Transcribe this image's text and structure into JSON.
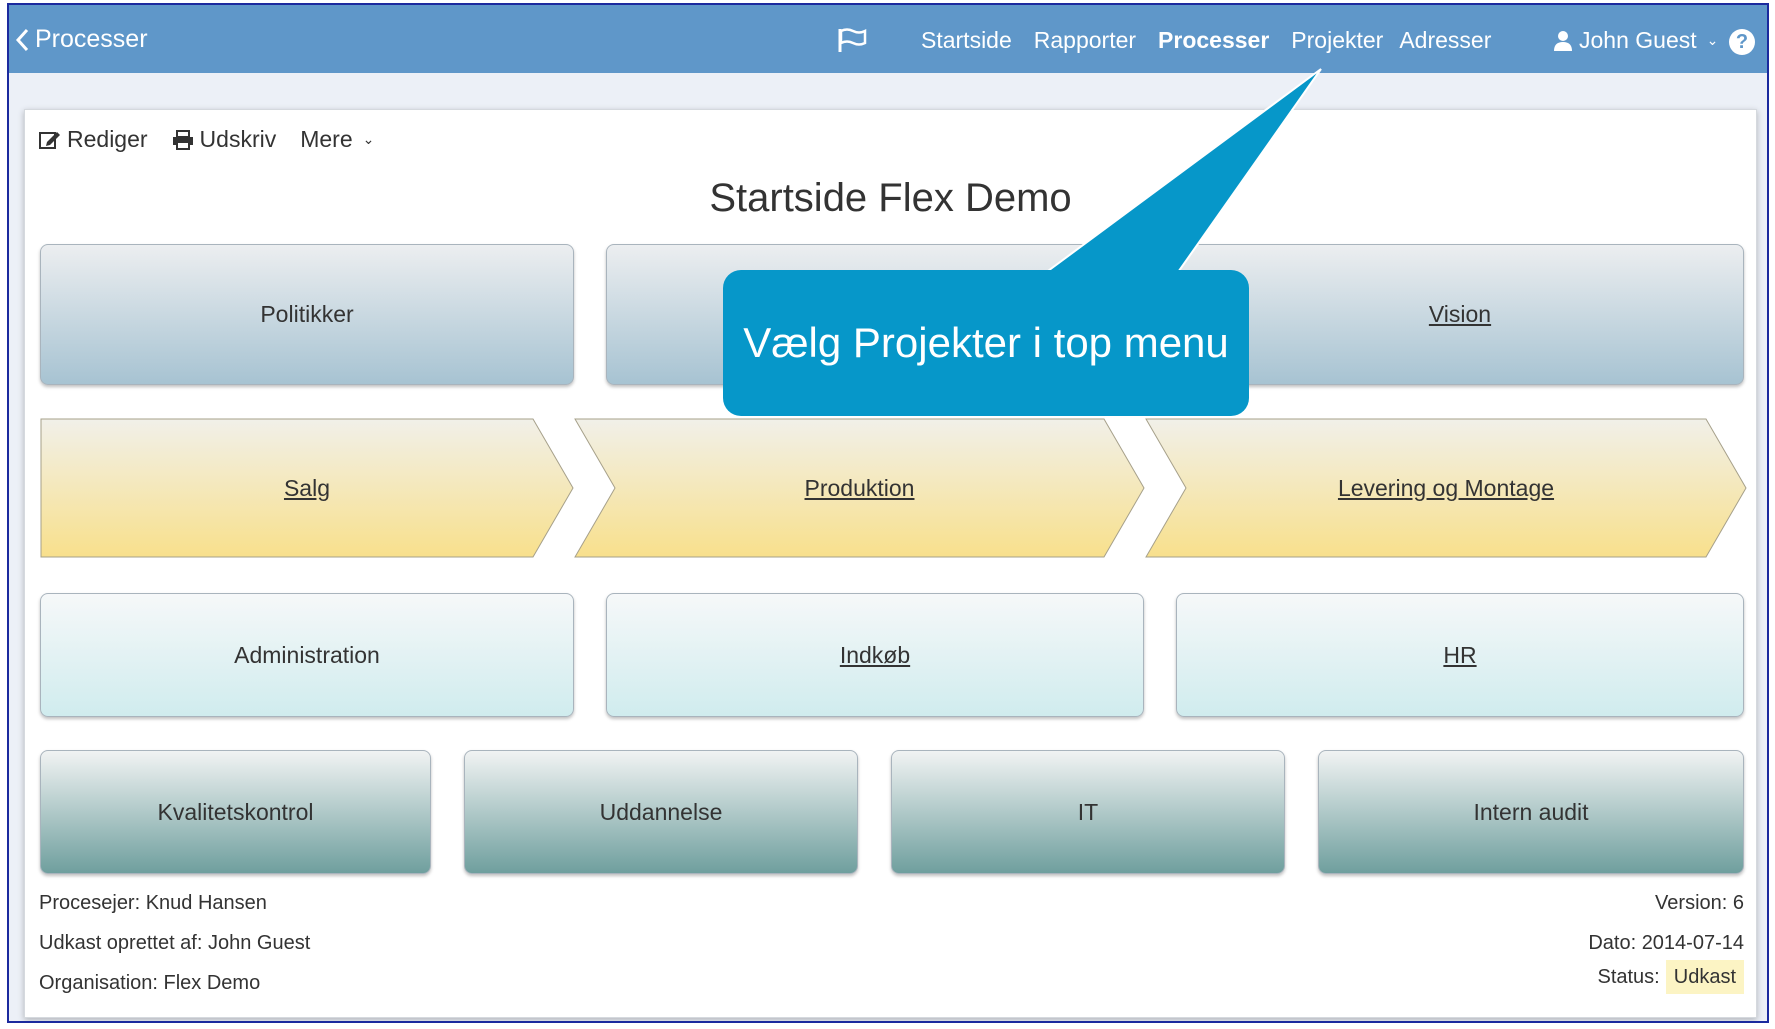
{
  "navbar": {
    "back_label": "Processer",
    "items": [
      "Startside",
      "Rapporter",
      "Processer",
      "Projekter",
      "Adresser"
    ],
    "active": "Processer",
    "user": "John Guest"
  },
  "toolbar": {
    "edit": "Rediger",
    "print": "Udskriv",
    "more": "Mere"
  },
  "page": {
    "title": "Startside Flex Demo"
  },
  "tiles": {
    "row1": [
      "Politikker",
      "",
      "Vision"
    ],
    "processes": [
      "Salg",
      "Produktion",
      "Levering og Montage"
    ],
    "row3": [
      "Administration",
      "Indkøb",
      "HR"
    ],
    "row4": [
      "Kvalitetskontrol",
      "Uddannelse",
      "IT",
      "Intern audit"
    ]
  },
  "meta": {
    "owner": "Procesejer: Knud Hansen",
    "draft_by": "Udkast oprettet af: John Guest",
    "organisation": "Organisation: Flex Demo",
    "version": "Version: 6",
    "date": "Dato: 2014-07-14",
    "status_label": "Status:",
    "status_value": "Udkast"
  },
  "callout": {
    "text": "Vælg Projekter i top menu"
  },
  "colors": {
    "navbar": "#5f97c9",
    "callout": "#0697c9",
    "process_arrow": "#f7e9a3",
    "status_badge": "#fcf4c4"
  }
}
